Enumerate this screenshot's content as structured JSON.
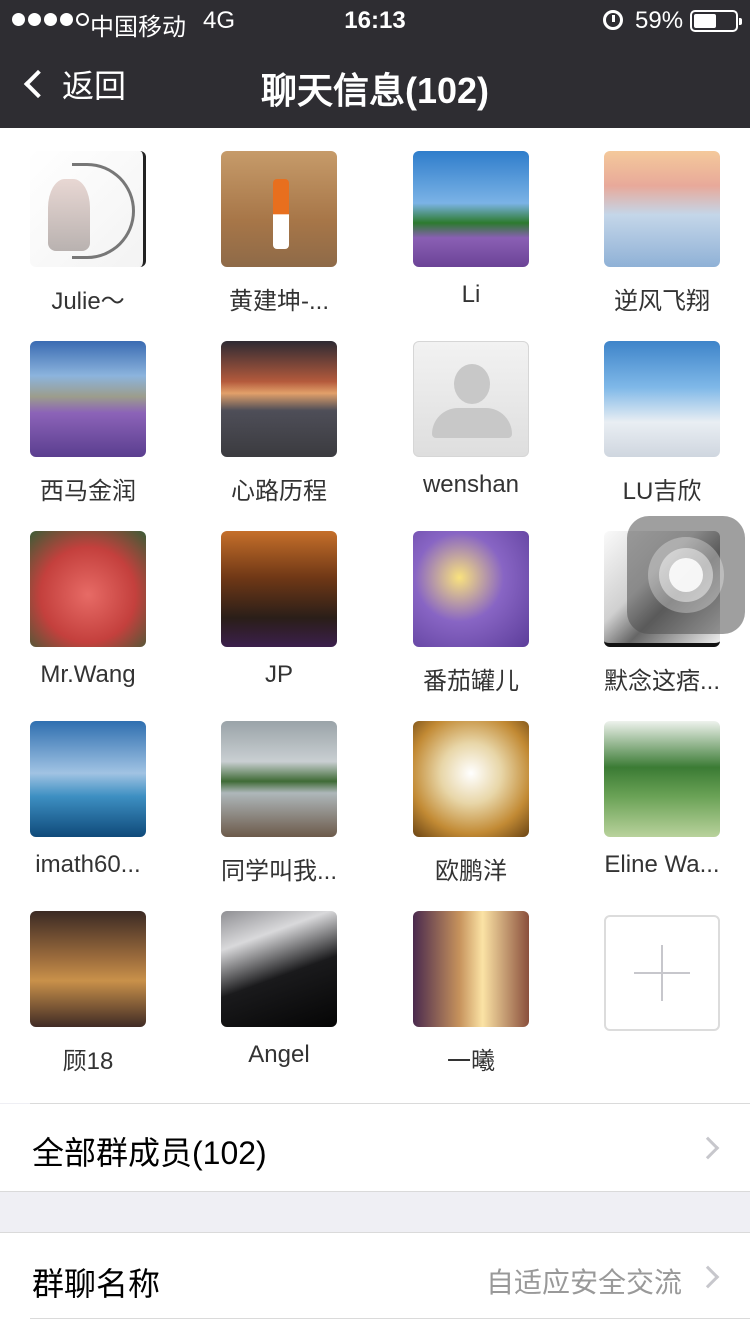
{
  "status_bar": {
    "carrier": "中国移动",
    "network": "4G",
    "time": "16:13",
    "battery": "59%",
    "battery_level": 0.59
  },
  "nav": {
    "back_label": "返回",
    "title": "聊天信息(102)"
  },
  "members": [
    {
      "name": "Julie～",
      "avatar": "av-julie"
    },
    {
      "name": "黄建坤-...",
      "avatar": "av-huang"
    },
    {
      "name": "Li",
      "avatar": "av-li"
    },
    {
      "name": "逆风飞翔",
      "avatar": "av-nifeng"
    },
    {
      "name": "西马金润",
      "avatar": "av-xima"
    },
    {
      "name": "心路历程",
      "avatar": "av-xinlu"
    },
    {
      "name": "wenshan",
      "avatar": "av-wenshan"
    },
    {
      "name": "LU吉欣",
      "avatar": "av-lu"
    },
    {
      "name": "Mr.Wang",
      "avatar": "av-wang"
    },
    {
      "name": "JP",
      "avatar": "av-jp"
    },
    {
      "name": "番茄罐儿",
      "avatar": "av-fanqie"
    },
    {
      "name": "默念这痞...",
      "avatar": "av-monian"
    },
    {
      "name": "imath60...",
      "avatar": "av-imath"
    },
    {
      "name": "同学叫我...",
      "avatar": "av-tongxue"
    },
    {
      "name": "欧鹏洋",
      "avatar": "av-oupeng"
    },
    {
      "name": "Eline Wa...",
      "avatar": "av-eline"
    },
    {
      "name": "顾18",
      "avatar": "av-gu"
    },
    {
      "name": "Angel",
      "avatar": "av-angel"
    },
    {
      "name": "一曦",
      "avatar": "av-yixi"
    }
  ],
  "all_members": {
    "label": "全部群成员(102)"
  },
  "group_name": {
    "label": "群聊名称",
    "value": "自适应安全交流"
  }
}
